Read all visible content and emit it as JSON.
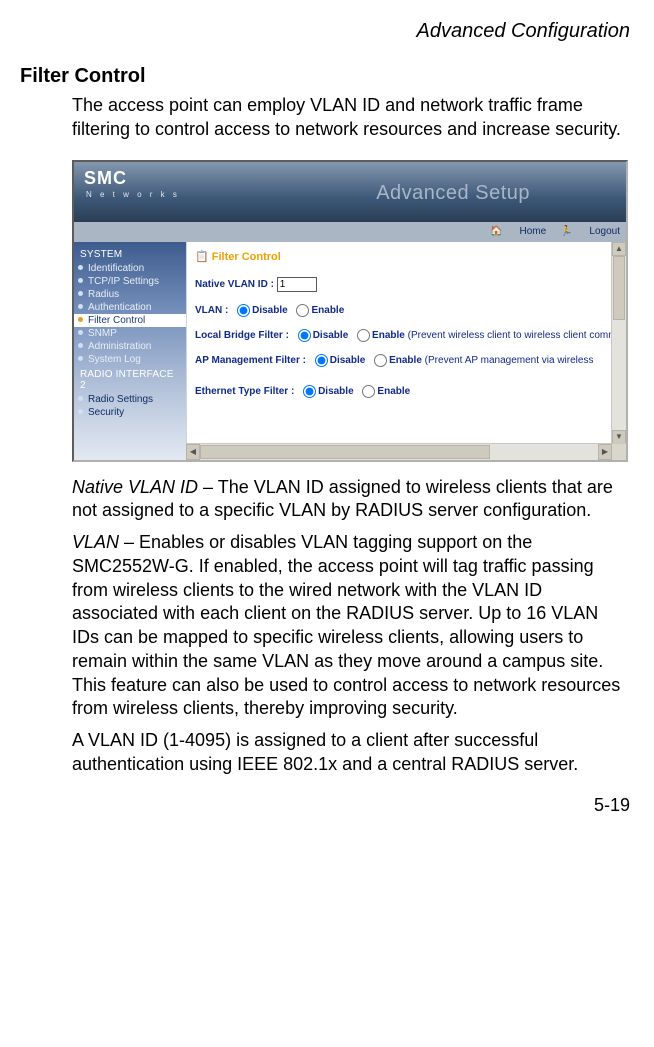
{
  "running_head": "Advanced Configuration",
  "section_title": "Filter Control",
  "intro": "The access point can employ VLAN ID and network traffic frame filtering to control access to network resources and increase security.",
  "screenshot": {
    "logo": "SMC",
    "logo_sub": "N e t w o r k s",
    "setup_title": "Advanced Setup",
    "topbar_home": "Home",
    "topbar_logout": "Logout",
    "group1_title": "SYSTEM",
    "nav": {
      "identification": "Identification",
      "tcpip": "TCP/IP Settings",
      "radius": "Radius",
      "authentication": "Authentication",
      "filter": "Filter Control",
      "snmp": "SNMP",
      "administration": "Administration",
      "syslog": "System Log"
    },
    "group2_title": "RADIO INTERFACE 2",
    "nav2": {
      "radio": "Radio Settings",
      "security": "Security"
    },
    "content_title": "Filter Control",
    "row1_label": "Native VLAN ID  :",
    "row1_value": "1",
    "row2_label": "VLAN  :",
    "row3_label": "Local Bridge Filter  :",
    "row3_note": "(Prevent wireless client to wireless client communication.)",
    "row4_label": "AP Management Filter  :",
    "row4_note": "(Prevent AP management via wireless",
    "row5_label": "Ethernet Type Filter  :",
    "opt_disable": "Disable",
    "opt_enable": "Enable"
  },
  "para1_term": "Native VLAN ID",
  "para1_body": " – The VLAN ID assigned to wireless clients that are not assigned to a specific VLAN by RADIUS server configuration.",
  "para2_term": "VLAN",
  "para2_body": " – Enables or disables VLAN tagging support on the SMC2552W-G. If enabled, the access point will tag traffic passing from wireless clients to the wired network with the VLAN ID associated with each client on the RADIUS server. Up to 16 VLAN IDs can be mapped to specific wireless clients, allowing users to remain within the same VLAN as they move around a campus site. This feature can also be used to control access to network resources from wireless clients, thereby improving security.",
  "para3": "A VLAN ID (1-4095) is assigned to a client after successful authentication using IEEE 802.1x and a central RADIUS server.",
  "pagenum": "5-19"
}
